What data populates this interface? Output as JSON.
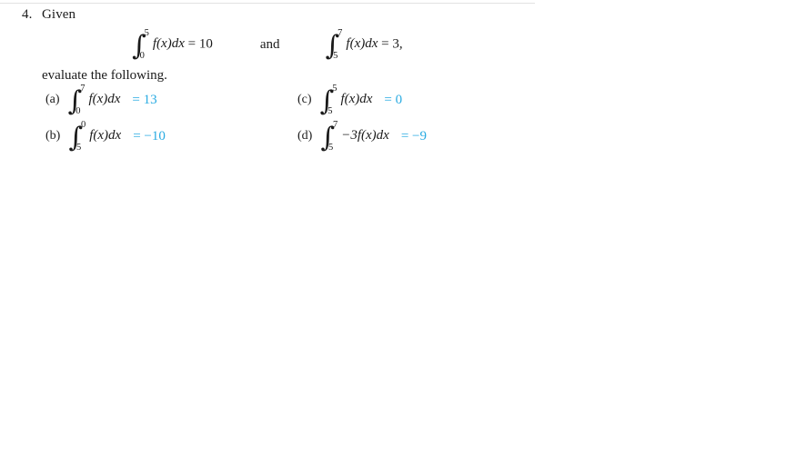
{
  "document": {
    "problem_number": "4.",
    "stem": "Given",
    "instruction": "evaluate the following.",
    "conjunction": "and",
    "accent_color": "#29abe2",
    "text_color": "#1a1a1a"
  },
  "givens": [
    {
      "id": "given-1",
      "lower": "0",
      "upper": "5",
      "integrand": "f(x)dx",
      "relation": "=",
      "value": "10",
      "trailing": ""
    },
    {
      "id": "given-2",
      "lower": "5",
      "upper": "7",
      "integrand": "f(x)dx",
      "relation": "=",
      "value": "3",
      "trailing": ","
    }
  ],
  "parts": [
    {
      "id": "part-a",
      "label": "(a)",
      "lower": "0",
      "upper": "7",
      "integrand": "f(x)dx",
      "answer": "= 13"
    },
    {
      "id": "part-b",
      "label": "(b)",
      "lower": "5",
      "upper": "0",
      "integrand": "f(x)dx",
      "answer": "= −10"
    },
    {
      "id": "part-c",
      "label": "(c)",
      "lower": "5",
      "upper": "5",
      "integrand": "f(x)dx",
      "answer": "= 0"
    },
    {
      "id": "part-d",
      "label": "(d)",
      "lower": "5",
      "upper": "7",
      "integrand": "−3f(x)dx",
      "answer": "= −9"
    }
  ]
}
